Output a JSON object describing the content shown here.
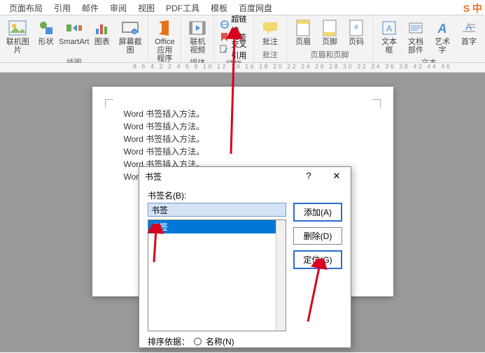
{
  "tabs": [
    "页面布局",
    "引用",
    "邮件",
    "审阅",
    "视图",
    "PDF工具",
    "模板",
    "百度网盘"
  ],
  "ribbon": {
    "groups": [
      {
        "label": "插图",
        "items": [
          {
            "label": "联机图片",
            "icon": "online-pic"
          },
          {
            "label": "形状",
            "icon": "shapes"
          },
          {
            "label": "SmartArt",
            "icon": "smartart"
          },
          {
            "label": "图表",
            "icon": "chart"
          },
          {
            "label": "屏幕截图",
            "icon": "screenshot"
          }
        ]
      },
      {
        "label": "应用程序",
        "items": [
          {
            "label": "Office\n应用程序",
            "icon": "office"
          }
        ]
      },
      {
        "label": "媒体",
        "items": [
          {
            "label": "联机视频",
            "icon": "video"
          }
        ]
      },
      {
        "label": "链接",
        "small": [
          {
            "label": "超链接",
            "icon": "link"
          },
          {
            "label": "书签",
            "icon": "bookmark"
          },
          {
            "label": "交叉引用",
            "icon": "crossref"
          }
        ]
      },
      {
        "label": "批注",
        "items": [
          {
            "label": "批注",
            "icon": "comment"
          }
        ]
      },
      {
        "label": "页眉和页脚",
        "items": [
          {
            "label": "页眉",
            "icon": "header"
          },
          {
            "label": "页脚",
            "icon": "footer"
          },
          {
            "label": "页码",
            "icon": "pagenum"
          }
        ]
      },
      {
        "label": "文本",
        "items": [
          {
            "label": "文本框",
            "icon": "textbox"
          },
          {
            "label": "文档部件",
            "icon": "parts"
          },
          {
            "label": "艺术字",
            "icon": "wordart"
          },
          {
            "label": "首字",
            "icon": "dropcap"
          }
        ]
      }
    ]
  },
  "ruler": "8 6 4 2  2 4 6 8 10 12 14 16 18 20 22 24 26 28 30 32 34 36 38  42 44 46",
  "doc": {
    "line": "Word 书签插入方法。",
    "repeat": 6
  },
  "dialog": {
    "title": "书签",
    "help": "?",
    "field_label": "书签名(B):",
    "input_value": "书签",
    "list_item": "书签",
    "buttons": {
      "add": "添加(A)",
      "delete": "删除(D)",
      "goto": "定位(G)"
    },
    "sort_label": "排序依据：",
    "sort_option": "名称(N)"
  },
  "logo": "S 中"
}
